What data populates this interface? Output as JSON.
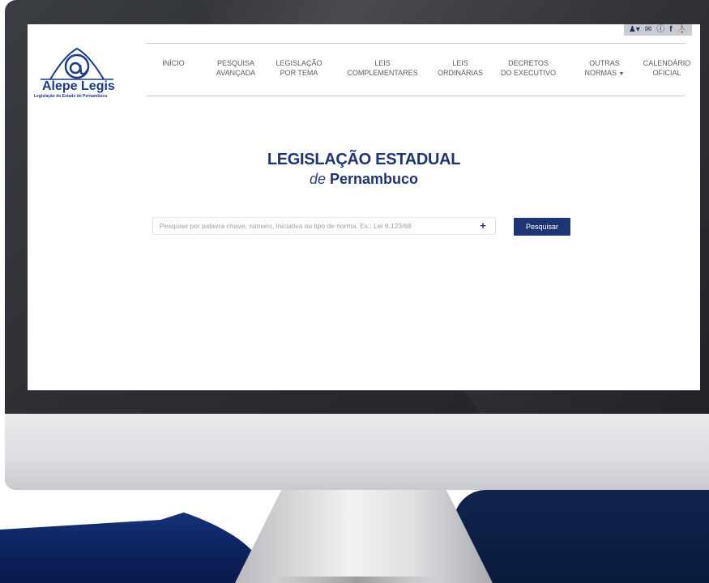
{
  "logo": {
    "name": "Alepe Legis",
    "subtitle": "Legislação do Estado de Pernambuco"
  },
  "top_icons": [
    "user-icon",
    "mail-icon",
    "info-icon",
    "facebook-icon",
    "building-icon"
  ],
  "nav": {
    "items": [
      {
        "line1": "INÍCIO",
        "line2": ""
      },
      {
        "line1": "PESQUISA",
        "line2": "AVANÇADA"
      },
      {
        "line1": "LEGISLAÇÃO",
        "line2": "POR TEMA"
      },
      {
        "line1": "LEIS",
        "line2": "COMPLEMENTARES"
      },
      {
        "line1": "LEIS",
        "line2": "ORDINÁRIAS"
      },
      {
        "line1": "DECRETOS",
        "line2": "DO EXECUTIVO"
      },
      {
        "line1": "OUTRAS",
        "line2": "NORMAS"
      },
      {
        "line1": "CALENDÁRIO",
        "line2": "OFICIAL"
      }
    ]
  },
  "heading": {
    "title": "LEGISLAÇÃO ESTADUAL",
    "sub_prefix": "de",
    "sub_state": "Pernambuco"
  },
  "search": {
    "placeholder": "Pesquise por palavra-chave, número, iniciativa ou tipo de norma. Ex.: Lei 6.123/68",
    "plus_label": "+",
    "button_label": "Pesquisar"
  },
  "colors": {
    "brand": "#1f3474",
    "wave": "#0d2563"
  }
}
